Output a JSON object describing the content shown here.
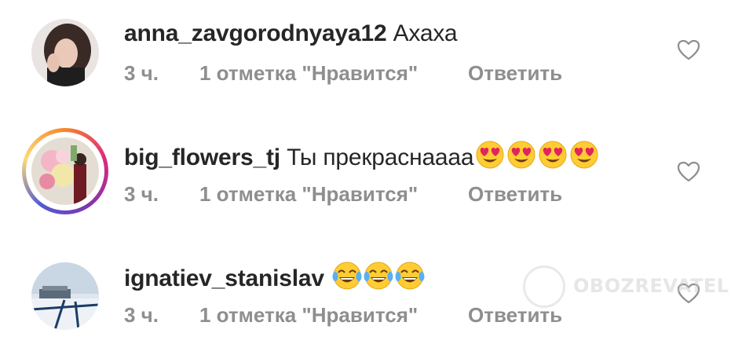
{
  "comments": [
    {
      "username": "anna_zavgorodnyaya12",
      "text": "Ахаха",
      "time": "3 ч.",
      "likes": "1 отметка \"Нравится\"",
      "reply": "Ответить",
      "emojis": []
    },
    {
      "username": "big_flowers_tj",
      "text": "Ты прекраснаааа",
      "time": "3 ч.",
      "likes": "1 отметка \"Нравится\"",
      "reply": "Ответить",
      "emojis": [
        "heart-eyes-emoji",
        "heart-eyes-emoji",
        "heart-eyes-emoji",
        "heart-eyes-emoji"
      ],
      "has_story_ring": true
    },
    {
      "username": "ignatiev_stanislav",
      "text": "",
      "time": "3 ч.",
      "likes": "1 отметка \"Нравится\"",
      "reply": "Ответить",
      "emojis": [
        "tears-of-joy-emoji",
        "tears-of-joy-emoji",
        "tears-of-joy-emoji"
      ]
    }
  ],
  "watermark": {
    "text": "OBOZREVATEL"
  },
  "colors": {
    "text": "#262626",
    "meta": "#8e8e8e",
    "heart_outline": "#8e8e8e"
  }
}
